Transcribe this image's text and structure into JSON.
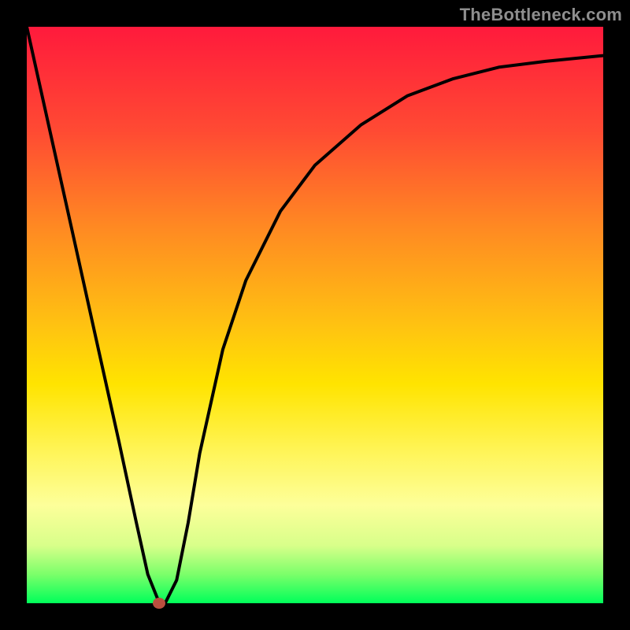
{
  "watermark": "TheBottleneck.com",
  "colors": {
    "frame": "#000000",
    "gradient_top": "#ff1a3c",
    "gradient_bottom": "#00ff5a",
    "curve": "#000000",
    "dot": "#bb4f3f"
  },
  "chart_data": {
    "type": "line",
    "title": "",
    "xlabel": "",
    "ylabel": "",
    "xlim": [
      0,
      100
    ],
    "ylim": [
      0,
      100
    ],
    "grid": false,
    "series": [
      {
        "name": "bottleneck_curve",
        "description": "Estimated bottleneck percentage (y) vs relative component strength (x); 0 = no bottleneck",
        "x": [
          0,
          4,
          8,
          12,
          16,
          19,
          21,
          23,
          24,
          26,
          28,
          30,
          34,
          38,
          44,
          50,
          58,
          66,
          74,
          82,
          90,
          100
        ],
        "y": [
          100,
          82,
          64,
          46,
          28,
          14,
          5,
          0,
          0,
          4,
          14,
          26,
          44,
          56,
          68,
          76,
          83,
          88,
          91,
          93,
          94,
          95
        ]
      }
    ],
    "marker": {
      "name": "selected_config",
      "x": 23,
      "y": 0
    }
  }
}
